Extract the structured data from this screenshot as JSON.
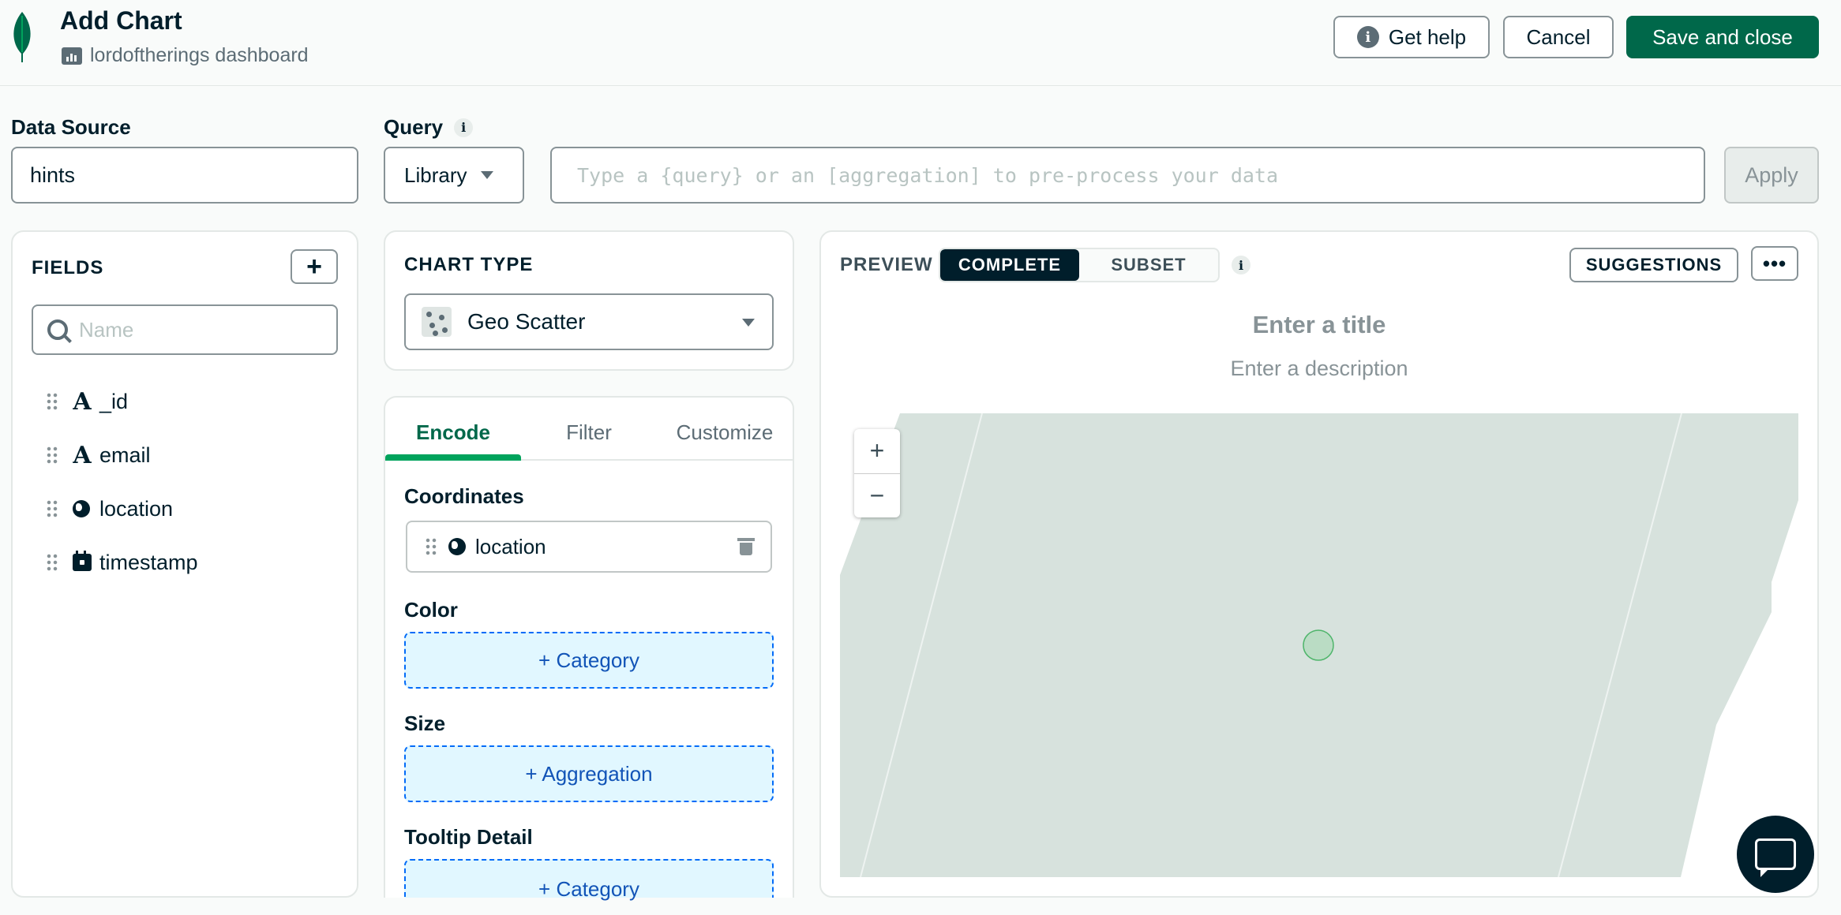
{
  "header": {
    "title": "Add Chart",
    "dashboard_name": "lordoftherings dashboard",
    "help_label": "Get help",
    "cancel_label": "Cancel",
    "save_label": "Save and close"
  },
  "data_source": {
    "label": "Data Source",
    "value": "hints"
  },
  "query": {
    "label": "Query",
    "mode": "Library",
    "placeholder": "Type a {query} or an [aggregation] to pre-process your data",
    "apply_label": "Apply"
  },
  "fields": {
    "title": "FIELDS",
    "search_placeholder": "Name",
    "items": [
      {
        "type_icon": "A",
        "label": "_id"
      },
      {
        "type_icon": "A",
        "label": "email"
      },
      {
        "type_icon": "globe-icon",
        "label": "location"
      },
      {
        "type_icon": "calendar-icon",
        "label": "timestamp"
      }
    ]
  },
  "chart_type": {
    "title": "CHART TYPE",
    "value": "Geo Scatter"
  },
  "encode": {
    "tabs": [
      "Encode",
      "Filter",
      "Customize"
    ],
    "active_tab": "Encode",
    "coordinates_label": "Coordinates",
    "coordinates_value": "location",
    "color_label": "Color",
    "color_drop": "+ Category",
    "size_label": "Size",
    "size_drop": "+ Aggregation",
    "tooltip_label": "Tooltip Detail",
    "tooltip_drop": "+ Category"
  },
  "preview": {
    "label": "PREVIEW",
    "segments": [
      "COMPLETE",
      "SUBSET"
    ],
    "active_segment": "COMPLETE",
    "suggestions_label": "SUGGESTIONS",
    "more_label": "•••",
    "title_placeholder": "Enter a title",
    "description_placeholder": "Enter a description",
    "zoom_in": "+",
    "zoom_out": "−"
  },
  "colors": {
    "brand_green": "#00684a",
    "accent_green": "#00a35c",
    "map_fill": "#d7e2dd",
    "drop_zone": "#e1f7ff"
  }
}
